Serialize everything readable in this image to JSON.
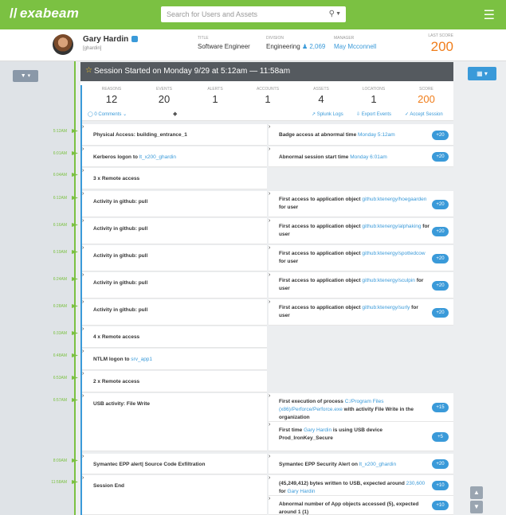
{
  "app": {
    "logo": "exabeam",
    "search_placeholder": "Search for Users and Assets"
  },
  "user": {
    "name": "Gary Hardin",
    "id": "[ghardin]",
    "title_label": "TITLE",
    "title": "Software Engineer",
    "division_label": "DIVISION",
    "division": "Engineering",
    "division_count": "2,069",
    "manager_label": "MANAGER",
    "manager": "May Mcconnell",
    "last_score_label": "LAST SCORE",
    "last_score": "200"
  },
  "session": {
    "title": "Session Started on Monday 9/29 at 5:12am — 11:58am",
    "stats": [
      {
        "label": "REASONS",
        "value": "12"
      },
      {
        "label": "EVENTS",
        "value": "20"
      },
      {
        "label": "ALERTS",
        "value": "1"
      },
      {
        "label": "ACCOUNTS",
        "value": "1"
      },
      {
        "label": "ASSETS",
        "value": "4"
      },
      {
        "label": "LOCATIONS",
        "value": "1"
      },
      {
        "label": "SCORE",
        "value": "200"
      }
    ],
    "comments": "0 Comments",
    "actions": {
      "splunk": "Splunk Logs",
      "export": "Export Events",
      "accept": "Accept Session"
    }
  },
  "events": [
    {
      "time": "5:12AM",
      "left": "Physical Access: building_entrance_1",
      "right": "Badge access at abnormal time ",
      "right_link": "Monday 5:12am",
      "score": "+20"
    },
    {
      "time": "6:01AM",
      "left": "Kerberos logon to ",
      "left_link": "lt_x200_ghardin",
      "right": "Abnormal session start time ",
      "right_link": "Monday 6:01am",
      "score": "+20"
    },
    {
      "time": "6:04AM",
      "left": "3 x Remote access"
    },
    {
      "time": "6:12AM",
      "left": "Activity in github: pull",
      "right": "First access to application object ",
      "right_link": "github:ktenergy/hoegaarden",
      "right_tail": " for user",
      "score": "+20"
    },
    {
      "time": "6:16AM",
      "left": "Activity in github: pull",
      "right": "First access to application object ",
      "right_link": "github:ktenergy/alphaking",
      "right_tail": " for user",
      "score": "+20"
    },
    {
      "time": "6:19AM",
      "left": "Activity in github: pull",
      "right": "First access to application object ",
      "right_link": "github:ktenergy/spottedcow",
      "right_tail": " for user",
      "score": "+20"
    },
    {
      "time": "6:24AM",
      "left": "Activity in github: pull",
      "right": "First access to application object ",
      "right_link": "github:ktenergy/sculpin",
      "right_tail": " for user",
      "score": "+20"
    },
    {
      "time": "6:28AM",
      "left": "Activity in github: pull",
      "right": "First access to application object ",
      "right_link": "github:ktenergy/surly",
      "right_tail": " for user",
      "score": "+20"
    },
    {
      "time": "6:33AM",
      "left": "4 x Remote access"
    },
    {
      "time": "6:48AM",
      "left": "NTLM logon to ",
      "left_link": "srv_app1"
    },
    {
      "time": "6:53AM",
      "left": "2 x Remote access"
    },
    {
      "time": "6:57AM",
      "left": "USB activity: File Write",
      "right": "First execution of process ",
      "right_link": "C:/Program Files (x86)/Perforce/Perforce.exe",
      "right_tail": " with activity File Write in the organization",
      "score": "+15",
      "right2": "First time ",
      "right2_link": "Gary Hardin",
      "right2_tail": " is using USB device Prod_IronKey_Secure",
      "score2": "+5"
    },
    {
      "time": "8:09AM",
      "left": "Symantec EPP alert| Source Code Exfiltration",
      "right": "Symantec EPP Security Alert on ",
      "right_link": "lt_x200_ghardin",
      "score": "+20"
    },
    {
      "time": "11:58AM",
      "left": "Session End",
      "right": "(45,249,412) bytes written to USB, expected around ",
      "right_link": "230,600",
      "right_tail": " for ",
      "right_link_b": "Gary Hardin",
      "score": "+10",
      "right2": "Abnormal number of App objects accessed (5), expected around 1 (1)",
      "score2": "+10"
    }
  ],
  "icons": {
    "logo": "exabeam-logo-icon",
    "search": "search-icon",
    "menu": "hamburger-icon",
    "filter": "filter-icon",
    "chart": "bar-chart-icon",
    "star": "star-icon",
    "tag": "tag-icon"
  },
  "colors": {
    "brand_green": "#7bc142",
    "accent_blue": "#3a9ad9",
    "score_orange": "#f07d1a",
    "session_header": "#555a5f"
  }
}
